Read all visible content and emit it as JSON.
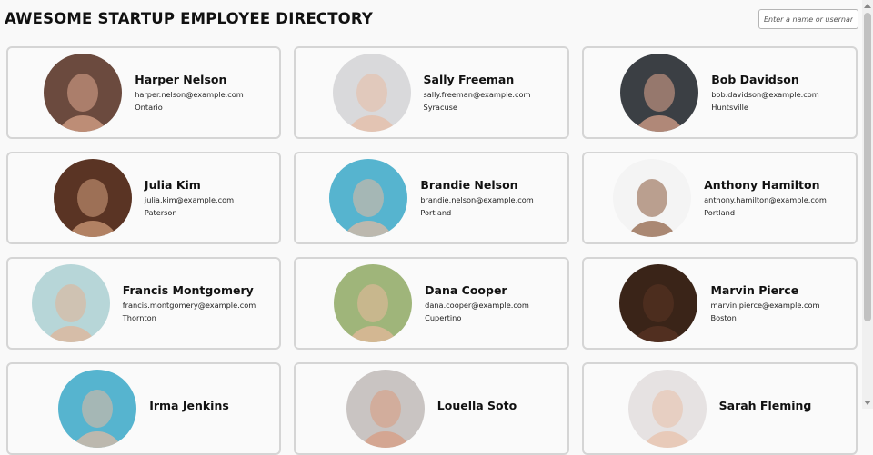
{
  "header": {
    "title": "AWESOME STARTUP EMPLOYEE DIRECTORY",
    "search_placeholder": "Enter a name or username"
  },
  "employees": [
    {
      "name": "Harper Nelson",
      "email": "harper.nelson@example.com",
      "city": "Ontario",
      "avatar_bg": "#6b4a3e",
      "avatar_skin": "#e0a98f"
    },
    {
      "name": "Sally Freeman",
      "email": "sally.freeman@example.com",
      "city": "Syracuse",
      "avatar_bg": "#d9d9db",
      "avatar_skin": "#e7bba2"
    },
    {
      "name": "Bob Davidson",
      "email": "bob.davidson@example.com",
      "city": "Huntsville",
      "avatar_bg": "#3b3f44",
      "avatar_skin": "#e2a88f"
    },
    {
      "name": "Julia Kim",
      "email": "julia.kim@example.com",
      "city": "Paterson",
      "avatar_bg": "#5a3424",
      "avatar_skin": "#d6a27f"
    },
    {
      "name": "Brandie Nelson",
      "email": "brandie.nelson@example.com",
      "city": "Portland",
      "avatar_bg": "#56b4cf",
      "avatar_skin": "#e8b9a0"
    },
    {
      "name": "Anthony Hamilton",
      "email": "anthony.hamilton@example.com",
      "city": "Portland",
      "avatar_bg": "#f4f4f4",
      "avatar_skin": "#8a5a3c"
    },
    {
      "name": "Francis Montgomery",
      "email": "francis.montgomery@example.com",
      "city": "Thornton",
      "avatar_bg": "#b7d6d8",
      "avatar_skin": "#e3b294"
    },
    {
      "name": "Dana Cooper",
      "email": "dana.cooper@example.com",
      "city": "Cupertino",
      "avatar_bg": "#9fb57a",
      "avatar_skin": "#e9b89c"
    },
    {
      "name": "Marvin Pierce",
      "email": "marvin.pierce@example.com",
      "city": "Boston",
      "avatar_bg": "#3a2418",
      "avatar_skin": "#5b3424"
    },
    {
      "name": "Irma Jenkins",
      "email": "",
      "city": "",
      "avatar_bg": "#56b4cf",
      "avatar_skin": "#e8b9a0"
    },
    {
      "name": "Louella Soto",
      "email": "",
      "city": "",
      "avatar_bg": "#c9c4c2",
      "avatar_skin": "#d89a7d"
    },
    {
      "name": "Sarah Fleming",
      "email": "",
      "city": "",
      "avatar_bg": "#e6e2e2",
      "avatar_skin": "#e8c0a8"
    }
  ]
}
